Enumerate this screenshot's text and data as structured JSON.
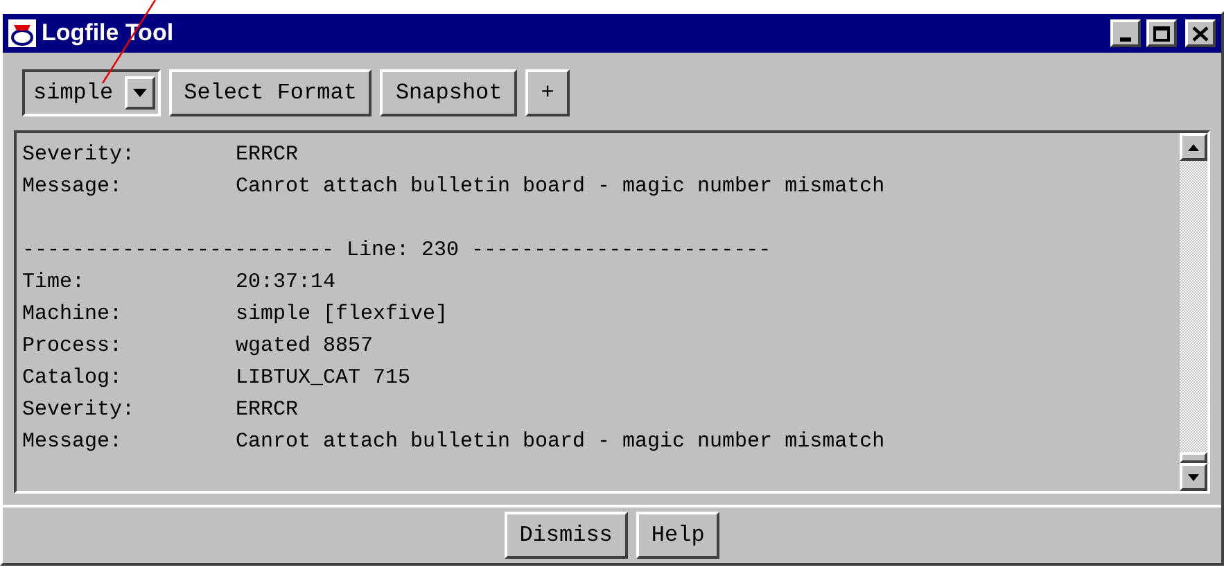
{
  "window": {
    "title": "Logfile Tool"
  },
  "toolbar": {
    "format_select": {
      "value": "simple"
    },
    "buttons": [
      "Select Format",
      "Snapshot",
      "+"
    ]
  },
  "log": {
    "lines": [
      {
        "kind": "field",
        "label": "Severity:",
        "value": "ERRCR"
      },
      {
        "kind": "field",
        "label": "Message:",
        "value": "Canrot attach bulletin board - magic number mismatch"
      },
      {
        "kind": "blank"
      },
      {
        "kind": "separator",
        "text": "------------------------- Line: 230 ------------------------"
      },
      {
        "kind": "field",
        "label": "Time:",
        "value": "20:37:14"
      },
      {
        "kind": "field",
        "label": "Machine:",
        "value": "simple [flexfive]"
      },
      {
        "kind": "field",
        "label": "Process:",
        "value": "wgated 8857"
      },
      {
        "kind": "field",
        "label": "Catalog:",
        "value": "LIBTUX_CAT 715"
      },
      {
        "kind": "field",
        "label": "Severity:",
        "value": "ERRCR"
      },
      {
        "kind": "field",
        "label": "Message:",
        "value": "Canrot attach bulletin board - magic number mismatch"
      }
    ]
  },
  "buttons": [
    "Dismiss",
    "Help"
  ]
}
